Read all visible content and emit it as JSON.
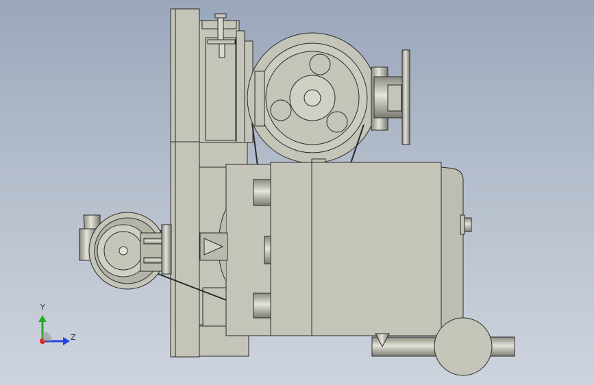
{
  "viewport": {
    "background_top": "#9aa7bb",
    "background_bottom": "#cdd4de"
  },
  "model": {
    "fill_color": "#c4c4b8",
    "fill_dark": "#8f8f86",
    "edge_color": "#2a2a2a",
    "highlight": "#e6e6dc"
  },
  "triad": {
    "y_label": "Y",
    "z_label": "Z",
    "y_color": "#22aa22",
    "z_color": "#2244dd",
    "x_color": "#dd2222"
  }
}
